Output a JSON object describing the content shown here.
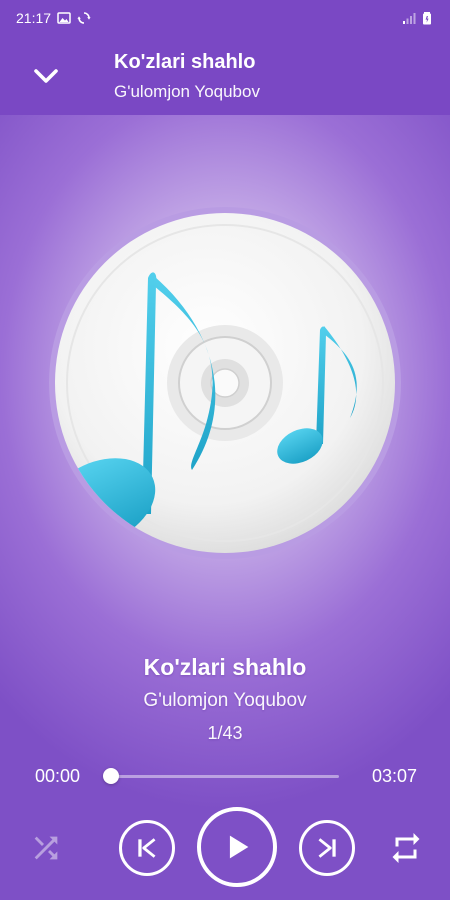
{
  "status_bar": {
    "time": "21:17",
    "icons": [
      "image-icon",
      "sync-icon",
      "signal-icon",
      "battery-icon"
    ]
  },
  "header": {
    "collapse_icon": "chevron-down-icon",
    "title": "Ko'zlari shahlo",
    "subtitle": "G'ulomjon Yoqubov"
  },
  "now_playing": {
    "album_art_icon": "music-disc-icon",
    "title": "Ko'zlari shahlo",
    "artist": "G'ulomjon Yoqubov",
    "position": "1/43"
  },
  "progress": {
    "elapsed": "00:00",
    "total": "03:07",
    "fraction": 0.0
  },
  "controls": {
    "shuffle_icon": "shuffle-icon",
    "shuffle_enabled": false,
    "previous_icon": "skip-previous-icon",
    "play_icon": "play-icon",
    "next_icon": "skip-next-icon",
    "repeat_icon": "repeat-icon"
  },
  "colors": {
    "header_background": "#7a48c4",
    "note_accent": "#2ab4d6",
    "foreground": "#ffffff"
  }
}
